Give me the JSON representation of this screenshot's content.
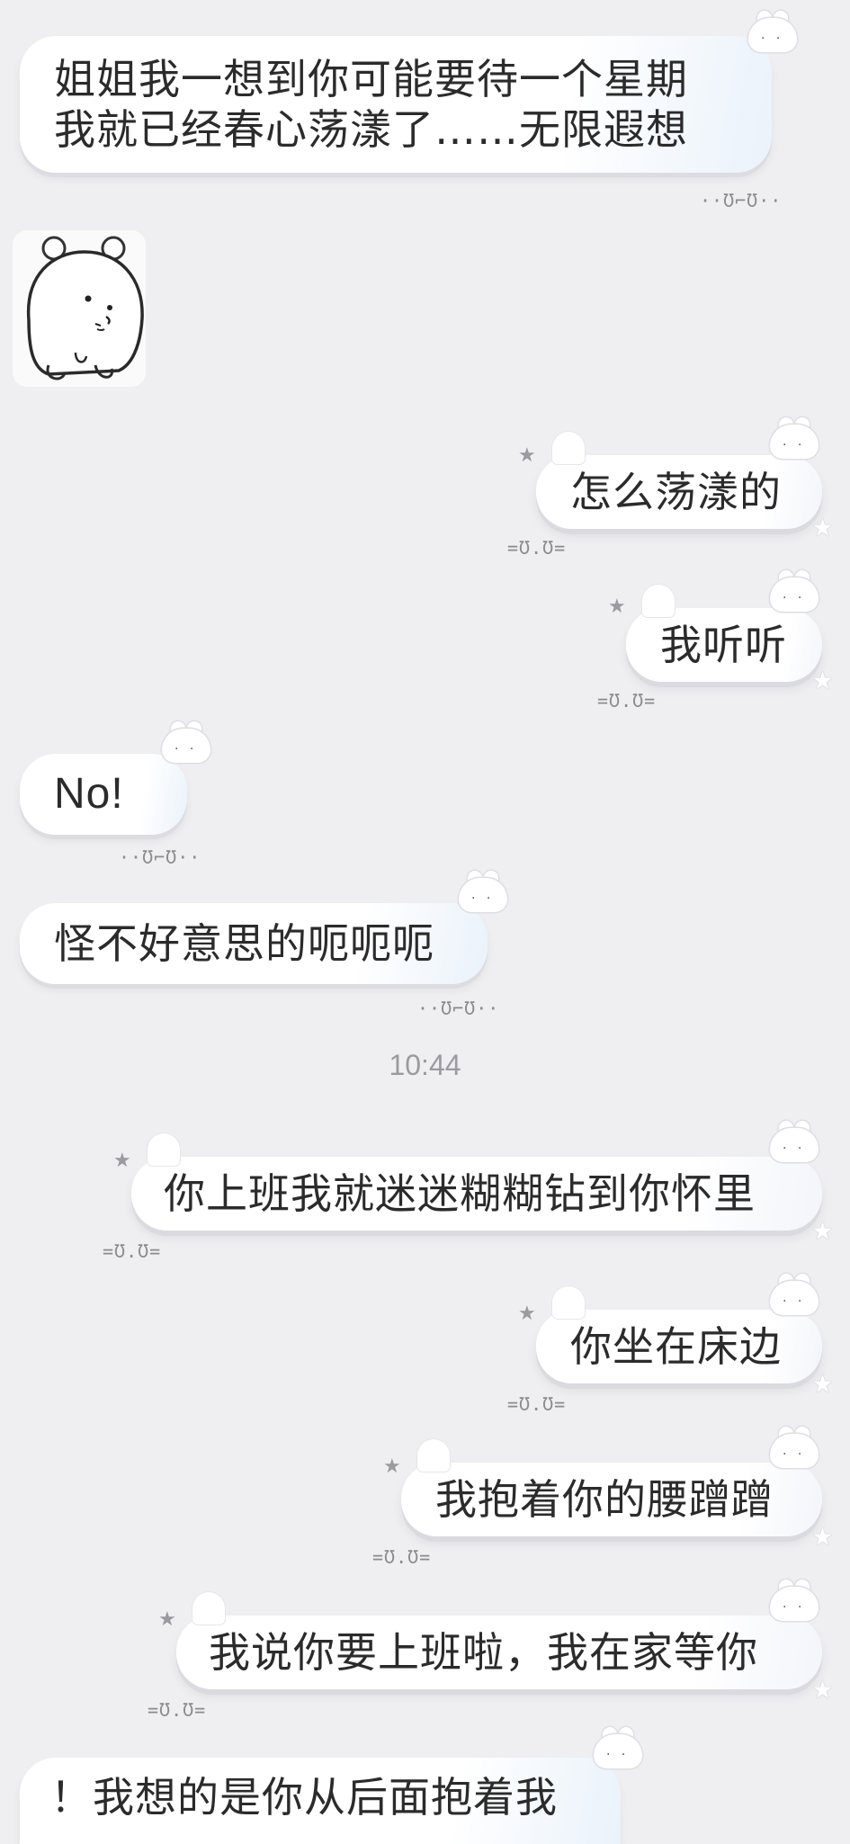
{
  "messages": [
    {
      "id": "m1",
      "side": "in",
      "text_lines": [
        "姐姐我一想到你可能要待一个星期",
        "我就已经春心荡漾了……无限遐想"
      ],
      "mark": "··Ʊ⌐Ʊ··"
    },
    {
      "id": "m2",
      "side": "in",
      "type": "sticker",
      "sticker_name": "bear-sticker"
    },
    {
      "id": "m3",
      "side": "out",
      "text": "怎么荡漾的",
      "mark": "=Ʊ.Ʊ="
    },
    {
      "id": "m4",
      "side": "out",
      "text": "我听听",
      "mark": "=Ʊ.Ʊ="
    },
    {
      "id": "m5",
      "side": "in",
      "text": "No!",
      "mark": "··Ʊ⌐Ʊ··"
    },
    {
      "id": "m6",
      "side": "in",
      "text": "怪不好意思的呃呃呃",
      "mark": "··Ʊ⌐Ʊ··"
    },
    {
      "id": "m7",
      "side": "out",
      "text": "你上班我就迷迷糊糊钻到你怀里",
      "mark": "=Ʊ.Ʊ="
    },
    {
      "id": "m8",
      "side": "out",
      "text": "你坐在床边",
      "mark": "=Ʊ.Ʊ="
    },
    {
      "id": "m9",
      "side": "out",
      "text": "我抱着你的腰蹭蹭",
      "mark": "=Ʊ.Ʊ="
    },
    {
      "id": "m10",
      "side": "out",
      "text": "我说你要上班啦，我在家等你",
      "mark": "=Ʊ.Ʊ="
    },
    {
      "id": "m11",
      "side": "in",
      "text": "！我想的是你从后面抱着我"
    }
  ],
  "timestamp": "10:44",
  "decor": {
    "star_glyph": "★",
    "bunny_face": "· ·",
    "bubble_color": "#ffffff",
    "background_color": "#efeff2"
  }
}
